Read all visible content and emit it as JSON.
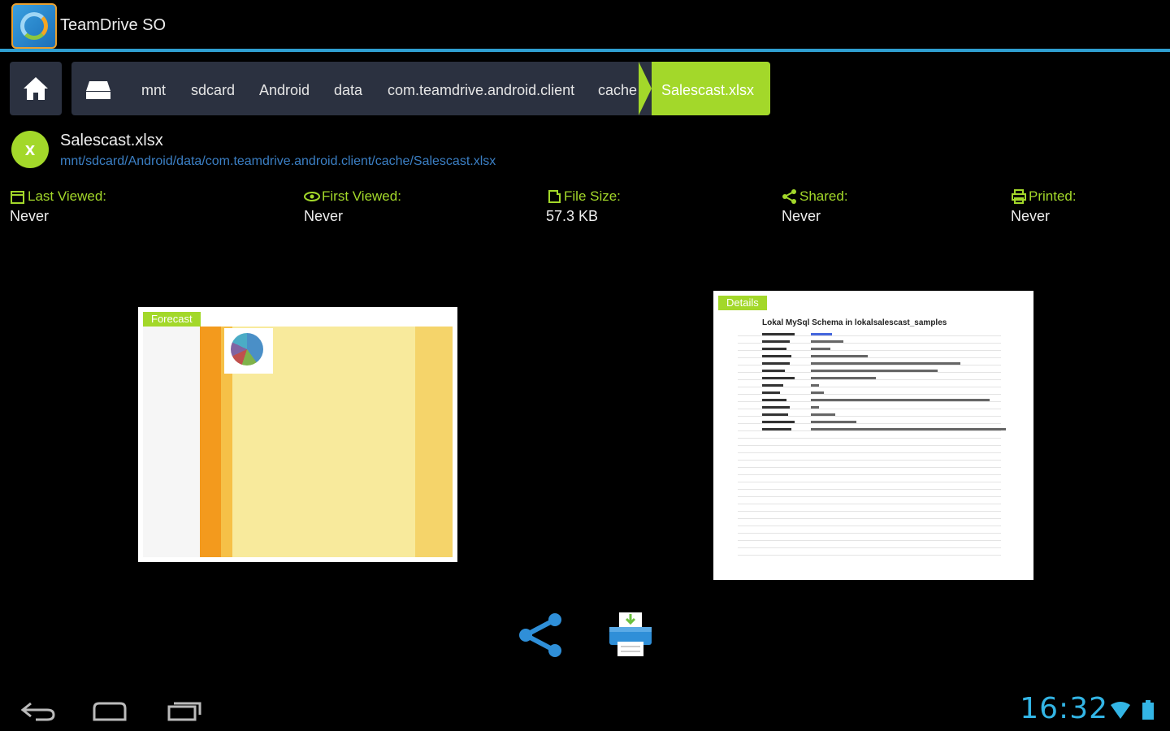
{
  "app": {
    "title": "TeamDrive SO",
    "icon": "teamdrive-logo-icon"
  },
  "breadcrumb": {
    "items": [
      "mnt",
      "sdcard",
      "Android",
      "data",
      "com.teamdrive.android.client",
      "cache"
    ],
    "active": "Salescast.xlsx"
  },
  "file": {
    "badge": "x",
    "name": "Salescast.xlsx",
    "path": "mnt/sdcard/Android/data/com.teamdrive.android.client/cache/Salescast.xlsx"
  },
  "stats": [
    {
      "label": "Last Viewed:",
      "value": "Never",
      "icon": "calendar-icon"
    },
    {
      "label": "First Viewed:",
      "value": "Never",
      "icon": "eye-icon"
    },
    {
      "label": "File Size:",
      "value": "57.3 KB",
      "icon": "disk-icon"
    },
    {
      "label": "Shared:",
      "value": "Never",
      "icon": "share-icon"
    },
    {
      "label": "Printed:",
      "value": "Never",
      "icon": "printer-icon"
    }
  ],
  "thumbnails": {
    "left_tab": "Forecast",
    "right_tab": "Details",
    "right_title": "Lokal MySql Schema in lokalsalescast_samples"
  },
  "clock": "16:32",
  "colors": {
    "accent": "#a3d82a",
    "blue": "#33b5e5",
    "bar": "#2b3140"
  }
}
